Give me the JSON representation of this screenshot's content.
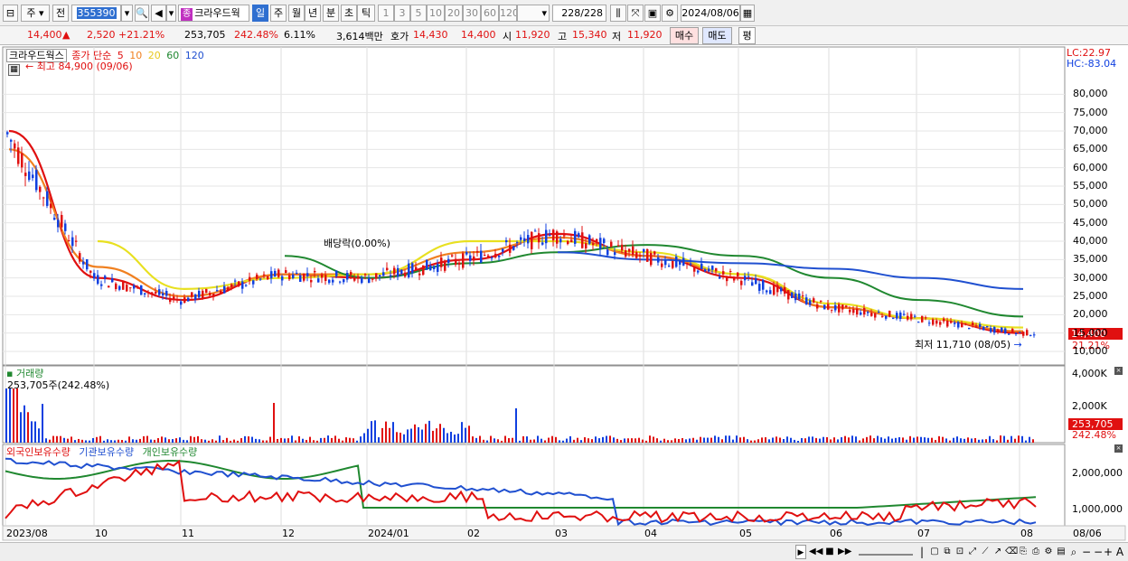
{
  "toolbar": {
    "market_label": "주",
    "jeon_label": "전",
    "stock_code": "355390",
    "jong_badge": "종",
    "stock_name": "크라우드웍",
    "periods": [
      "일",
      "주",
      "월",
      "년",
      "분",
      "초",
      "틱"
    ],
    "active_period": "일",
    "intervals": [
      "1",
      "3",
      "5",
      "10",
      "20",
      "30",
      "60",
      "120"
    ],
    "count_display": "228/228",
    "date_value": "2024/08/06"
  },
  "quote": {
    "price": "14,400",
    "change_arrow": "▲",
    "change": "2,520",
    "change_pct": "+21.21%",
    "volume": "253,705",
    "volume_pct": "242.48%",
    "turnover_pct": "6.11%",
    "trade_value": "3,614백만",
    "ask_label": "호가",
    "ask1": "14,430",
    "ask2": "14,400",
    "open_label": "시",
    "open": "11,920",
    "high_label": "고",
    "high": "15,340",
    "low_label": "저",
    "low": "11,920",
    "buy_button": "매수",
    "sell_button": "매도",
    "eval_button": "평"
  },
  "price_pane": {
    "legend_name": "크라우드웍스",
    "legend_desc": "종가 단순",
    "ma_periods": [
      "5",
      "10",
      "20",
      "60",
      "120"
    ],
    "ma_colors": [
      "#e01010",
      "#f08020",
      "#e8e020",
      "#208830",
      "#2050d0"
    ],
    "lc_label": "LC:22.97",
    "hc_label": "HC:-83.04",
    "max_annotation": "최고 84,900 (09/06)",
    "min_annotation": "최저 11,710 (08/05)",
    "dividend_annotation": "배당락(0.00%)",
    "y_ticks": [
      "80,000",
      "75,000",
      "70,000",
      "65,000",
      "60,000",
      "55,000",
      "50,000",
      "45,000",
      "40,000",
      "35,000",
      "30,000",
      "25,000",
      "20,000",
      "15,000",
      "10,000"
    ],
    "current_price_tag": "14,400",
    "current_pct_tag": "21.21%"
  },
  "volume_pane": {
    "title": "거래량",
    "value_label": "253,705주(242.48%)",
    "y_ticks": [
      "4,000K",
      "2,000K"
    ],
    "current_tag": "253,705",
    "current_pct": "242.48%"
  },
  "holdings_pane": {
    "legend": [
      "외국인보유수량",
      "기관보유수량",
      "개인보유수량"
    ],
    "legend_colors": [
      "#e01010",
      "#2050d0",
      "#208830"
    ],
    "y_ticks": [
      "2,000,000",
      "1,000,000"
    ]
  },
  "x_axis": {
    "labels": [
      "2023/08",
      "10",
      "11",
      "12",
      "2024/01",
      "02",
      "03",
      "04",
      "05",
      "06",
      "07",
      "08"
    ],
    "last_label": "08/06"
  },
  "chart_data": {
    "type": "line",
    "title": "",
    "xlabel": "",
    "ylabel": "",
    "ylim": [
      10000,
      85000
    ],
    "x": [
      "2023/08",
      "10",
      "11",
      "12",
      "2024/01",
      "02",
      "03",
      "04",
      "05",
      "06",
      "07",
      "08"
    ],
    "series": [
      {
        "name": "5",
        "values": [
          70000,
          30000,
          24000,
          31000,
          30000,
          35000,
          42000,
          36000,
          30000,
          22000,
          19000,
          15000
        ]
      },
      {
        "name": "10",
        "values": [
          65000,
          33000,
          25000,
          31000,
          31000,
          37000,
          41000,
          36000,
          31000,
          22000,
          19000,
          15500
        ]
      },
      {
        "name": "20",
        "values": [
          null,
          40000,
          27000,
          30000,
          31000,
          40000,
          40000,
          37000,
          31000,
          23000,
          19000,
          16500
        ]
      },
      {
        "name": "60",
        "values": [
          null,
          null,
          null,
          36000,
          30000,
          34000,
          37000,
          39000,
          36000,
          30000,
          24000,
          19500
        ]
      },
      {
        "name": "120",
        "values": [
          null,
          null,
          null,
          null,
          null,
          null,
          37000,
          35000,
          34000,
          32500,
          30000,
          27000
        ]
      }
    ]
  }
}
